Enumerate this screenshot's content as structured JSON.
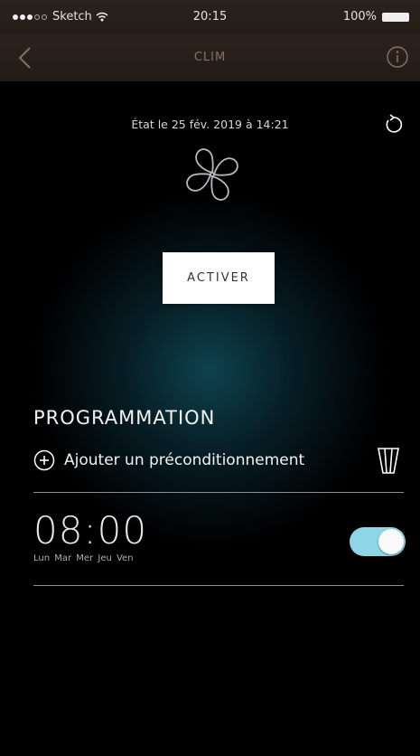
{
  "status_bar": {
    "carrier": "Sketch",
    "time": "20:15",
    "battery": "100%"
  },
  "nav": {
    "title": "CLIM"
  },
  "status": {
    "state_text": "État le 25 fév. 2019 à 14:21"
  },
  "actions": {
    "activate_label": "ACTIVER"
  },
  "programming": {
    "title": "PROGRAMMATION",
    "add_label": "Ajouter un préconditionnement",
    "schedules": [
      {
        "time": "08:00",
        "days": "Lun Mar Mer Jeu Ven",
        "enabled": true
      }
    ]
  },
  "colors": {
    "toggle_on": "#8ed6e6",
    "nav_background": "#2a221d",
    "title_color": "#8a6f62"
  },
  "icons": [
    "back-chevron-icon",
    "info-icon",
    "refresh-icon",
    "fan-icon",
    "plus-circle-icon",
    "trash-icon",
    "wifi-icon"
  ]
}
